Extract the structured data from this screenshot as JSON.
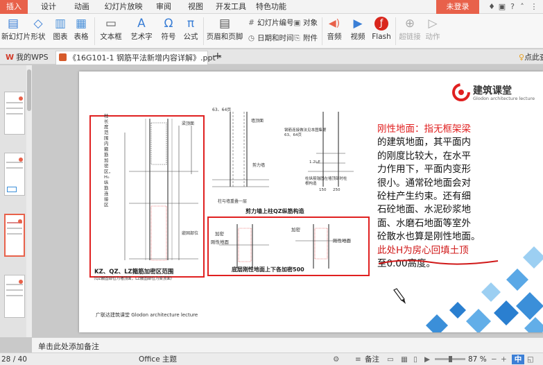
{
  "menu": {
    "tabs": [
      "插入",
      "设计",
      "动画",
      "幻灯片放映",
      "审阅",
      "视图",
      "开发工具",
      "特色功能"
    ],
    "active_index": 0,
    "login_label": "未登录"
  },
  "ribbon": {
    "buttons": [
      {
        "label": "新幻灯片",
        "icon": "new-slide-icon",
        "glyph": "▤"
      },
      {
        "label": "形状",
        "icon": "shapes-icon",
        "glyph": "◇"
      },
      {
        "label": "图表",
        "icon": "chart-icon",
        "glyph": "▥"
      },
      {
        "label": "表格",
        "icon": "table-icon",
        "glyph": "▦"
      },
      {
        "label": "文本框",
        "icon": "textbox-icon",
        "glyph": "▭"
      },
      {
        "label": "艺术字",
        "icon": "wordart-icon",
        "glyph": "A"
      },
      {
        "label": "符号",
        "icon": "symbol-icon",
        "glyph": "Ω"
      },
      {
        "label": "公式",
        "icon": "formula-icon",
        "glyph": "π"
      },
      {
        "label": "页眉和页脚",
        "icon": "header-footer-icon",
        "glyph": "▤"
      },
      {
        "label": "音频",
        "icon": "audio-icon",
        "glyph": "◀)"
      },
      {
        "label": "视频",
        "icon": "video-icon",
        "glyph": "▶"
      },
      {
        "label": "Flash",
        "icon": "flash-icon",
        "glyph": "ƒ"
      },
      {
        "label": "超链接",
        "icon": "hyperlink-icon",
        "glyph": "⊕"
      },
      {
        "label": "动作",
        "icon": "action-icon",
        "glyph": "▷"
      }
    ],
    "small": [
      {
        "label": "幻灯片编号",
        "icon": "slide-number-icon",
        "glyph": "#"
      },
      {
        "label": "对象",
        "icon": "object-icon",
        "glyph": "▣"
      },
      {
        "label": "日期和时间",
        "icon": "date-time-icon",
        "glyph": "◷"
      },
      {
        "label": "附件",
        "icon": "attachment-icon",
        "glyph": "⎘"
      }
    ]
  },
  "doc_tabs": {
    "home_label": "我的WPS",
    "file_label": "《16G101-1 钢筋平法新增内容详解》.ppt *",
    "right_label": "点此查"
  },
  "slide": {
    "brand_cn": "建筑课堂",
    "brand_en": "Glodon architecture lecture",
    "term": "刚性地面",
    "body_lines": [
      "：指无框架梁",
      "的建筑地面，其平面内",
      "的刚度比较大，在水平",
      "力作用下，平面内变形",
      "很小。通常砼地面会对",
      "砼柱产生约束。还有细",
      "石砼地面、水泥砂浆地",
      "面、水磨石地面等室外",
      "砼散水也算是刚性地面。"
    ],
    "underlined_line": "此处H为房心回填土顶",
    "last_line": "至0.00高度。",
    "diagram": {
      "title_bottom_left": "KZ、QZ、LZ箍筋加密区范围",
      "note_bottom_left": "（QZ嵌固部位为墙顶面，LZ嵌固部位为梁顶面）",
      "vertical_label": "柱长度范围内箍筋加密区，H₀纵筋连接区",
      "mid_title": "剪力墙上柱QZ纵筋构造",
      "box_title": "底层刚性地面上下各加密500",
      "label_beam_top": "梁顶面",
      "label_wall_top": "墙顶面",
      "label_shear_wall": "剪力墙",
      "label_encase": "柱与墙重叠一层",
      "label_connect": "钢筋连接做法见本图集第63、64页",
      "label_anchor": "柱纵筋锚固在墙顶部时柱根构造",
      "label_dense": "加密",
      "label_rigid": "刚性地面",
      "label_embed": "嵌固部位",
      "label_64": "63、64页",
      "label_lae": "1.2lₐE",
      "label_150": "150",
      "label_250": "250"
    },
    "footer": "广联达建筑课堂   Glodon architecture lecture"
  },
  "notes_placeholder": "单击此处添加备注",
  "status": {
    "page": "28 / 40",
    "theme": "Office 主题",
    "notes_label": "备注",
    "zoom": "87 %"
  },
  "colors": {
    "accent": "#e8614a",
    "red_text": "#e02020",
    "frame_red": "#e02020"
  }
}
